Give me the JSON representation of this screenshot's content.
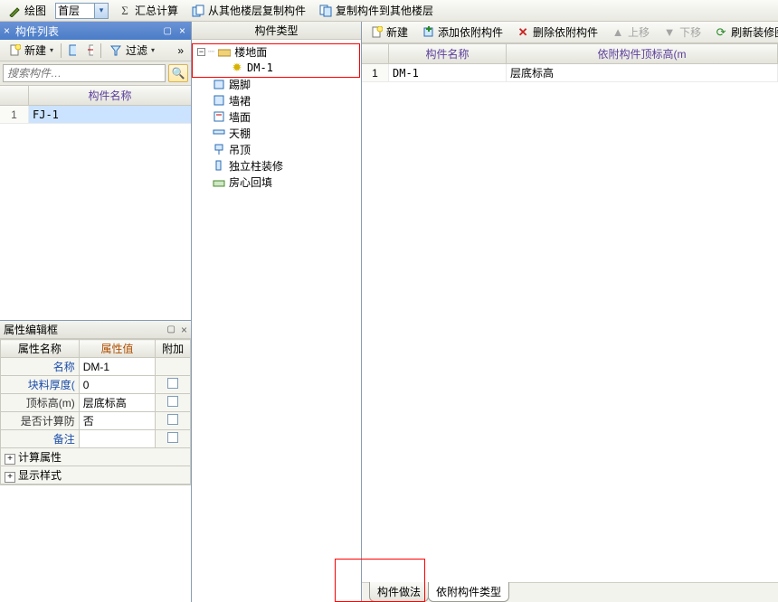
{
  "top_toolbar": {
    "draw_btn": "绘图",
    "floor_combo_value": "首层",
    "sum_btn": "汇总计算",
    "copy_from_btn": "从其他楼层复制构件",
    "copy_to_btn": "复制构件到其他楼层"
  },
  "left_panel": {
    "title": "构件列表",
    "toolbar": {
      "new_label": "新建",
      "filter_label": "过滤"
    },
    "search_placeholder": "搜索构件…",
    "grid_header": "构件名称",
    "rows": [
      {
        "idx": "1",
        "name": "FJ-1"
      }
    ]
  },
  "prop_panel": {
    "title": "属性编辑框",
    "head_name": "属性名称",
    "head_val": "属性值",
    "head_extra": "附加",
    "rows": [
      {
        "name": "名称",
        "val": "DM-1",
        "chk": false
      },
      {
        "name": "块料厚度(",
        "val": "0",
        "chk": true
      },
      {
        "name": "顶标高(m)",
        "val": "层底标高",
        "chk": true
      },
      {
        "name": "是否计算防",
        "val": "否",
        "chk": true
      },
      {
        "name": "备注",
        "val": "",
        "chk": true
      }
    ],
    "expand_rows": [
      {
        "label": "计算属性"
      },
      {
        "label": "显示样式"
      }
    ]
  },
  "tree_panel": {
    "title": "构件类型",
    "root": "楼地面",
    "root_child": "DM-1",
    "nodes": [
      "踢脚",
      "墙裙",
      "墙面",
      "天棚",
      "吊顶",
      "独立柱装修",
      "房心回填"
    ]
  },
  "right_panel": {
    "toolbar": {
      "new_btn": "新建",
      "add_dep": "添加依附构件",
      "del_dep": "删除依附构件",
      "move_up": "上移",
      "move_down": "下移",
      "refresh": "刷新装修图元"
    },
    "grid_header": {
      "c1": "构件名称",
      "c2": "依附构件顶标高(m"
    },
    "rows": [
      {
        "idx": "1",
        "name": "DM-1",
        "top": "层底标高"
      }
    ],
    "bottom_tabs": {
      "t1": "构件做法",
      "t2": "依附构件类型"
    }
  }
}
